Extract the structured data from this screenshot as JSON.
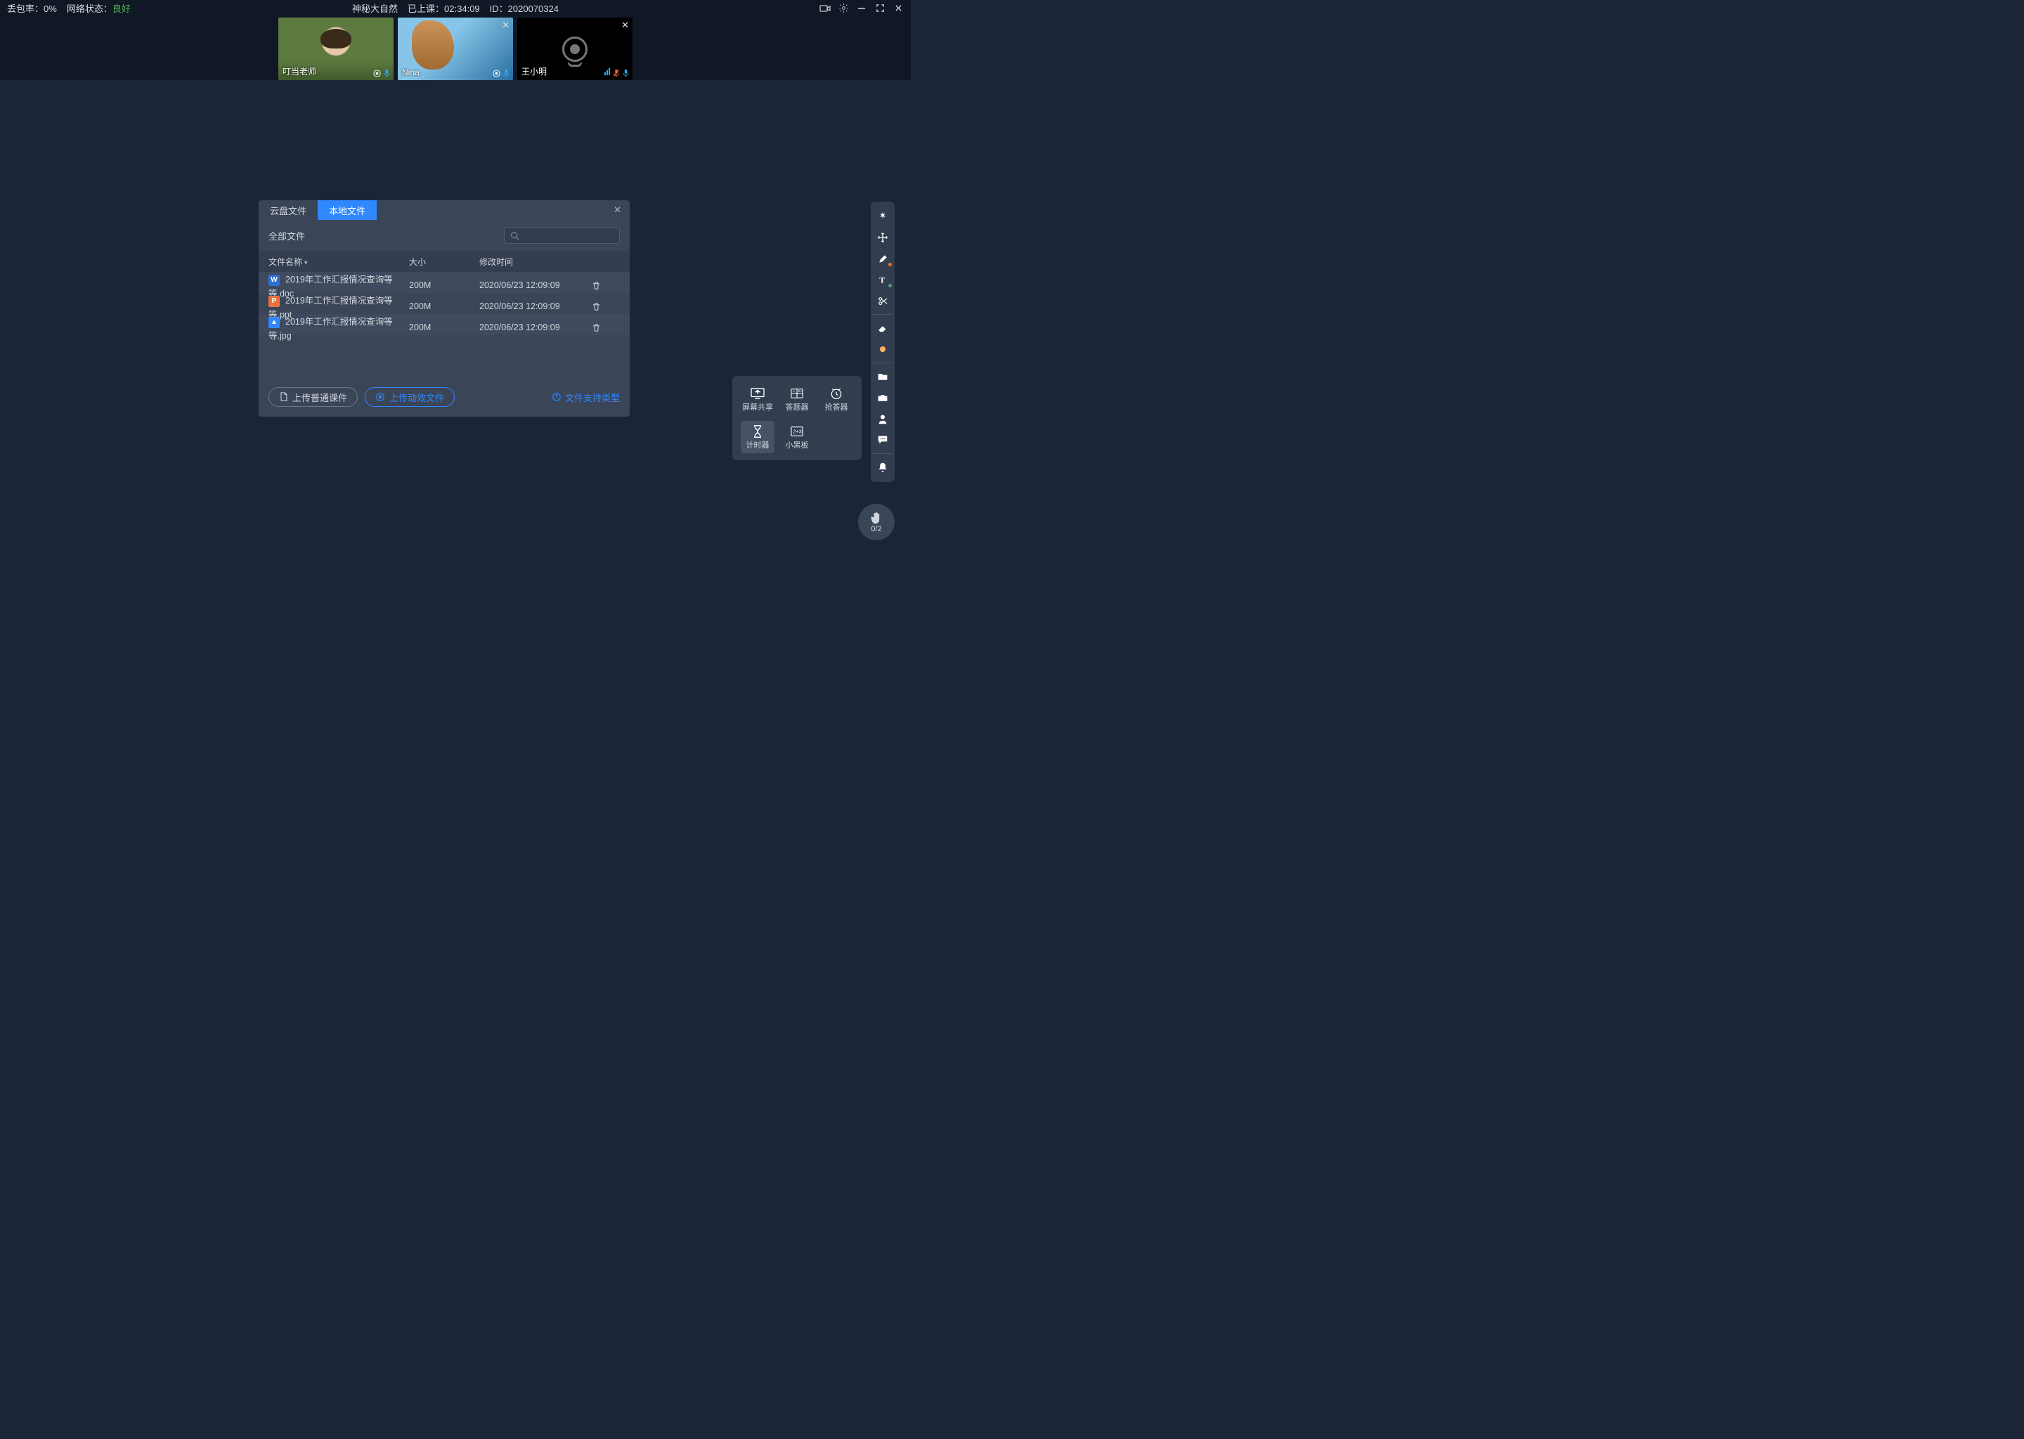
{
  "status": {
    "packet_loss_label": "丢包率：",
    "packet_loss_value": "0%",
    "net_label": "网络状态：",
    "net_value": "良好",
    "title": "神秘大自然",
    "elapsed_label": "已上课：",
    "elapsed_value": "02:34:09",
    "id_label": "ID：",
    "id_value": "2020070324"
  },
  "participants": [
    {
      "name": "叮当老师",
      "camera": "on",
      "closeable": false,
      "mic_muted": false
    },
    {
      "name": "Nina",
      "camera": "on",
      "closeable": true,
      "mic_muted": false
    },
    {
      "name": "王小明",
      "camera": "off",
      "closeable": true,
      "mic_muted": true
    }
  ],
  "file_dialog": {
    "tabs": {
      "cloud": "云盘文件",
      "local": "本地文件"
    },
    "active_tab": "local",
    "breadcrumb": "全部文件",
    "columns": {
      "name": "文件名称",
      "size": "大小",
      "mtime": "修改时间"
    },
    "rows": [
      {
        "icon": "doc",
        "name": "2019年工作汇报情况查询等等.doc",
        "size": "200M",
        "mtime": "2020/06/23 12:09:09"
      },
      {
        "icon": "ppt",
        "name": "2019年工作汇报情况查询等等.ppt",
        "size": "200M",
        "mtime": "2020/06/23 12:09:09"
      },
      {
        "icon": "img",
        "name": "2019年工作汇报情况查询等等.jpg",
        "size": "200M",
        "mtime": "2020/06/23 12:09:09"
      }
    ],
    "upload_normal": "上传普通课件",
    "upload_dynamic": "上传动效文件",
    "help": "文件支持类型"
  },
  "tools_pop": {
    "screen_share": "屏幕共享",
    "answer_machine": "答题器",
    "responder": "抢答器",
    "timer": "计时器",
    "mini_board": "小黑板"
  },
  "right_bar": {
    "items": [
      "pointer",
      "move",
      "pen",
      "text",
      "scissors",
      "eraser",
      "dot",
      "folder",
      "toolbox",
      "user",
      "chat",
      "bell"
    ]
  },
  "hand_raise": {
    "count": "0/2"
  }
}
